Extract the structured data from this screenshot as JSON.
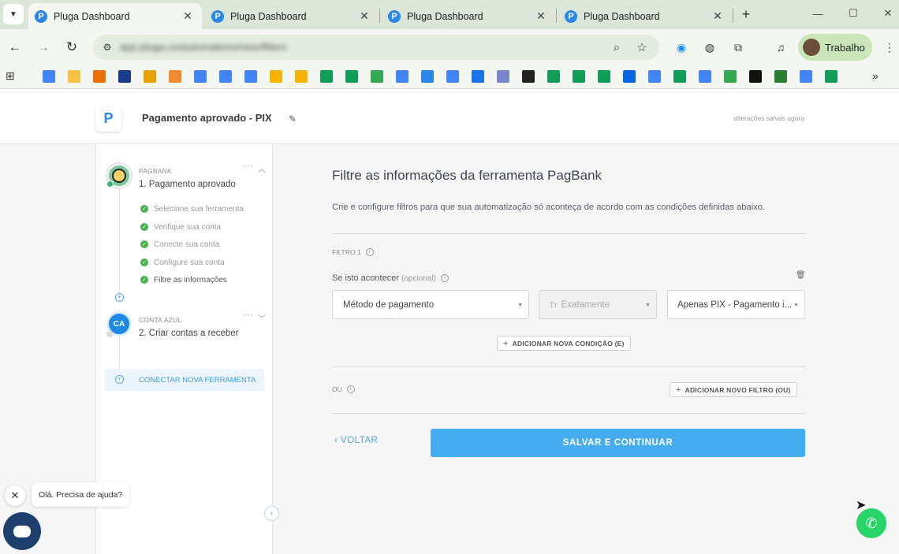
{
  "browser": {
    "tabs": [
      {
        "title": "Pluga Dashboard",
        "active": true
      },
      {
        "title": "Pluga Dashboard",
        "active": false
      },
      {
        "title": "Pluga Dashboard",
        "active": false
      },
      {
        "title": "Pluga Dashboard",
        "active": false
      }
    ],
    "profile_label": "Trabalho",
    "url": "app.pluga.co/automations/new/filters",
    "bookmark_colors": [
      "#4285f4",
      "#f5c242",
      "#e8710a",
      "#1a3a8a",
      "#e8a200",
      "#f28b2d",
      "#4285f4",
      "#4285f4",
      "#4285f4",
      "#f4b400",
      "#f4b400",
      "#0f9d58",
      "#0f9d58",
      "#34a853",
      "#4285f4",
      "#2a86e8",
      "#4285f4",
      "#1a73e8",
      "#7986cb",
      "#222222",
      "#0f9d58",
      "#0f9d58",
      "#0f9d58",
      "#0668e1",
      "#4285f4",
      "#0f9d58",
      "#4285f4",
      "#34a853",
      "#111111",
      "#2e7d32",
      "#4285f4",
      "#0f9d58"
    ]
  },
  "app": {
    "automation_name": "Pagamento aprovado - PIX",
    "save_status": "alterações salvas agora"
  },
  "sidebar": {
    "tool1": {
      "category": "PAGBANK",
      "name": "1. Pagamento aprovado",
      "steps": [
        "Selecione sua ferramenta",
        "Verifique sua conta",
        "Conecte sua conta",
        "Configure sua conta",
        "Filtre as informações"
      ]
    },
    "tool2": {
      "category": "CONTA AZUL",
      "icon_text": "CA",
      "name": "2. Criar contas a receber"
    },
    "connect_new": "CONECTAR NOVA FERRAMENTA"
  },
  "main": {
    "title": "Filtre as informações da ferramenta PagBank",
    "description": "Crie e configure filtros para que sua automatização só aconteça de acordo com as condições definidas abaixo.",
    "filter_label": "FILTRO 1",
    "condition_label": "Se isto acontecer",
    "condition_optional": "(opcional)",
    "field_select": "Método de pagamento",
    "operator_select": "Exatamente",
    "value_select": "Apenas PIX - Pagamento i...",
    "add_condition": "ADICIONAR NOVA CONDIÇÃO (E)",
    "or_label": "OU",
    "add_filter": "ADICIONAR NOVO FILTRO (OU)",
    "back_label": "VOLTAR",
    "save_label": "SALVAR E CONTINUAR"
  },
  "chat": {
    "greeting": "Olá. Precisa de ajuda?"
  }
}
